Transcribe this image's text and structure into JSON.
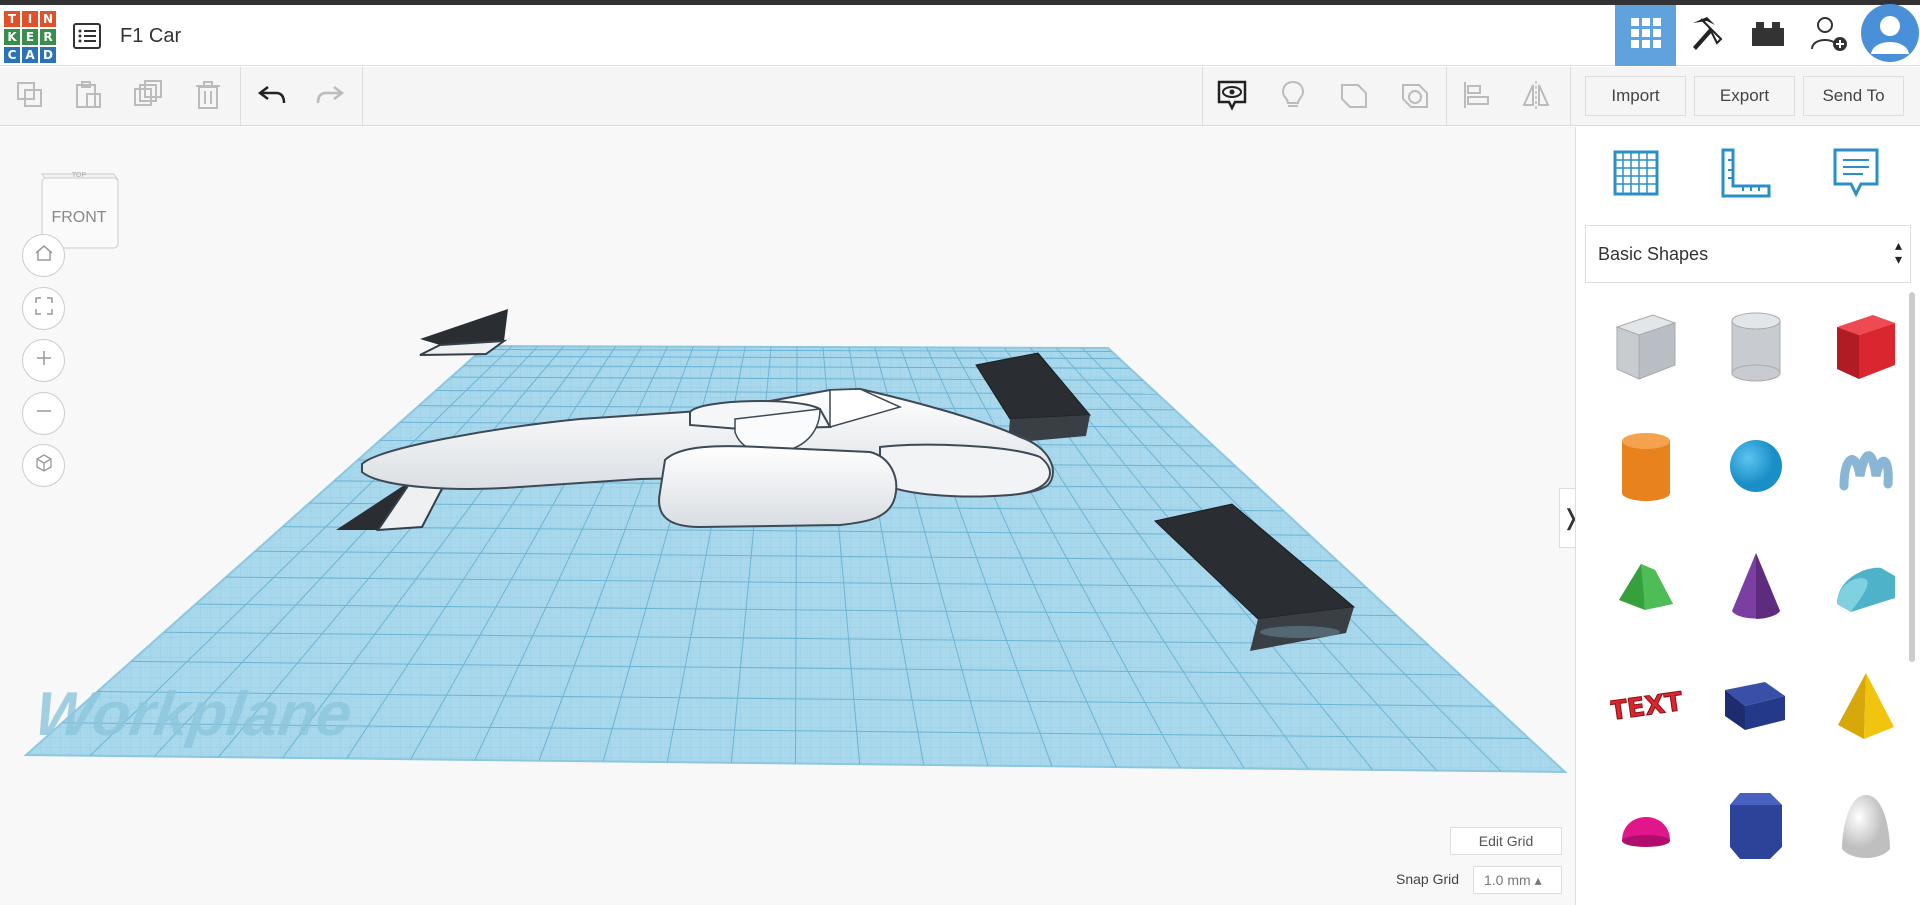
{
  "app": {
    "logo_letters": [
      "T",
      "I",
      "N",
      "K",
      "E",
      "R",
      "C",
      "A",
      "D"
    ],
    "logo_colors": [
      "#e2502a",
      "#e2502a",
      "#e2502a",
      "#3a8d4c",
      "#3a8d4c",
      "#3a8d4c",
      "#2b73b9",
      "#2b73b9",
      "#2b73b9"
    ],
    "project_title": "F1 Car"
  },
  "header": {
    "buttons": [
      {
        "name": "3d-design-view-button",
        "icon": "grid-icon",
        "active": true
      },
      {
        "name": "minecraft-view-button",
        "icon": "pickaxe-icon",
        "active": false
      },
      {
        "name": "bricks-view-button",
        "icon": "brick-icon",
        "active": false
      },
      {
        "name": "invite-user-button",
        "icon": "add-user-icon",
        "active": false
      },
      {
        "name": "account-avatar",
        "icon": "avatar-icon",
        "active": false
      }
    ]
  },
  "toolbar": {
    "left_icons": [
      "copy-icon",
      "paste-icon",
      "duplicate-icon",
      "delete-icon",
      "undo-icon",
      "redo-icon"
    ],
    "right_icons": [
      "notes-visibility-icon",
      "light-icon",
      "shape-icon",
      "hole-icon",
      "align-icon",
      "mirror-icon"
    ],
    "import_label": "Import",
    "export_label": "Export",
    "sendto_label": "Send To"
  },
  "canvas": {
    "viewcube_front": "FRONT",
    "viewcube_top": "TOP",
    "nav_icons": [
      "home-icon",
      "fit-view-icon",
      "zoom-in-icon",
      "zoom-out-icon",
      "perspective-icon"
    ],
    "workplane_label": "Workplane",
    "edit_grid_label": "Edit Grid",
    "snap_grid_label": "Snap Grid",
    "snap_grid_value": "1.0 mm ▴",
    "collapse_label": "❭",
    "workplane_color": "#a9d8ec",
    "accent": "#5fa2dd"
  },
  "panel": {
    "top_icons": [
      "workplane-icon",
      "ruler-icon",
      "notes-icon"
    ],
    "shape_category": "Basic Shapes",
    "shapes": [
      {
        "name": "box-hole",
        "color": "#c8ccd1"
      },
      {
        "name": "cylinder-hole",
        "color": "#c8ccd1"
      },
      {
        "name": "box",
        "color": "#d9262f"
      },
      {
        "name": "cylinder",
        "color": "#e8821c"
      },
      {
        "name": "sphere",
        "color": "#1a8fc7"
      },
      {
        "name": "scribble",
        "color": "#8ab6d6"
      },
      {
        "name": "roof",
        "color": "#36a13c"
      },
      {
        "name": "cone",
        "color": "#7b3ea3"
      },
      {
        "name": "round-roof",
        "color": "#4eb2c9"
      },
      {
        "name": "text",
        "color": "#d9262f"
      },
      {
        "name": "wedge",
        "color": "#25398a"
      },
      {
        "name": "pyramid",
        "color": "#f1c40f"
      },
      {
        "name": "half-sphere",
        "color": "#e0168a"
      },
      {
        "name": "polygon",
        "color": "#2d4399"
      },
      {
        "name": "paraboloid",
        "color": "#d5d5d5"
      }
    ]
  }
}
